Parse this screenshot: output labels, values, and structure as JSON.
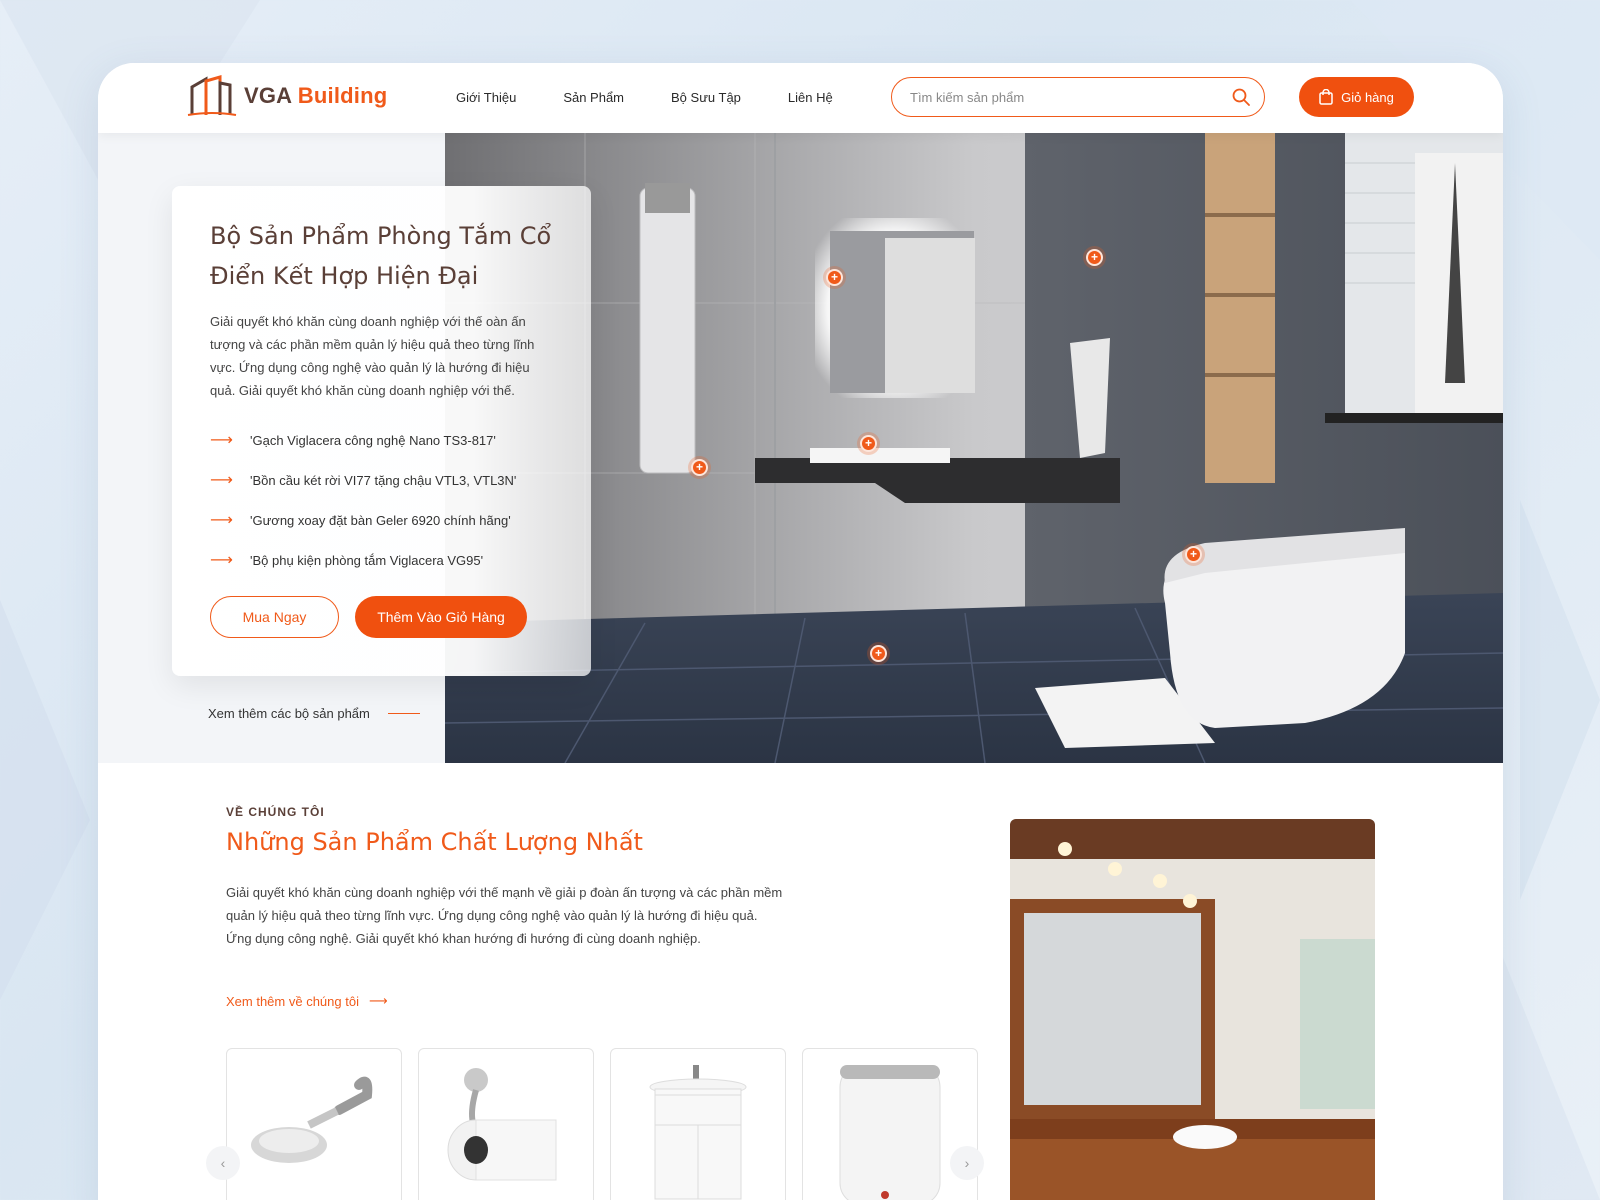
{
  "brand": {
    "name_part1": "VGA",
    "name_part2": "Building",
    "accent": "#f05a1a",
    "dark": "#5a3f37"
  },
  "nav": {
    "items": [
      "Giới Thiệu",
      "Sản Phẩm",
      "Bộ Sưu Tập",
      "Liên Hệ"
    ]
  },
  "search": {
    "placeholder": "Tìm kiếm sản phẩm",
    "icon": "search-icon"
  },
  "cart": {
    "label": "Giỏ hàng",
    "icon": "shopping-bag-icon"
  },
  "hero": {
    "title": "Bộ Sản Phẩm Phòng Tắm Cổ Điển Kết Hợp Hiện Đại",
    "description": "Giải quyết khó khăn cùng doanh nghiệp với thế oàn ấn tượng và các phần mềm quản lý hiệu quả theo từng lĩnh vực. Ứng dụng công nghệ vào quản lý là hướng đi hiệu quả. Giải quyết khó khăn cùng doanh nghiệp với thế.",
    "features": [
      "'Gạch Viglacera công nghệ Nano TS3-817'",
      "'Bồn cầu két rời VI77 tặng chậu VTL3, VTL3N'",
      "'Gương xoay đặt bàn Geler 6920 chính hãng'",
      "'Bộ phụ kiện phòng tắm Viglacera VG95'"
    ],
    "buy_now": "Mua Ngay",
    "add_to_cart": "Thêm Vào Giỏ Hàng",
    "see_more": "Xem thêm các bộ sản phẩm"
  },
  "about": {
    "eyebrow": "VỀ CHÚNG TÔI",
    "title": "Những Sản Phẩm Chất Lượng Nhất",
    "description": "Giải quyết khó khăn cùng doanh nghiệp với thế mạnh về giải p đoàn ấn tượng và các phần mềm quản lý hiệu quả theo từng lĩnh vực. Ứng dụng công nghệ vào quản lý là hướng đi hiệu quả. Ứng dụng công nghệ. Giải quyết khó khan hướng đi hướng đi cùng doanh nghiệp.",
    "link": "Xem thêm về chúng tôi",
    "products": [
      "shower-head",
      "toilet-paper-holder",
      "vanity-cabinet",
      "water-heater"
    ]
  }
}
